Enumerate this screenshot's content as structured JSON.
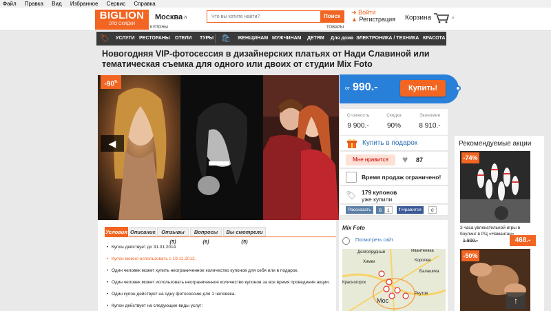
{
  "menubar": [
    "Файл",
    "Правка",
    "Вид",
    "Избранное",
    "Сервис",
    "Справка"
  ],
  "header": {
    "logo_main": "BIGLION",
    "logo_sub": "ЭТО СКИДКИ",
    "city": "Москва",
    "search_placeholder": "Что вы хотите найти?",
    "search_button": "Поиск",
    "login": "Войти",
    "register": "Регистрация",
    "cart": "Корзина",
    "label_coupons": "КУПОНЫ",
    "label_goods": "ТОВАРЫ"
  },
  "nav": {
    "coupons": [
      "УСЛУГИ",
      "РЕСТОРАНЫ",
      "ОТЕЛИ",
      "ТУРЫ"
    ],
    "goods": [
      "ЖЕНЩИНАМ",
      "МУЖЧИНАМ",
      "ДЕТЯМ",
      "Для дома",
      "ЭЛЕКТРОНИКА / ТЕХНИКА",
      "КРАСОТА"
    ]
  },
  "deal": {
    "title": "Новогодняя VIP-фотосессия в дизайнерских платьях от Нади Славиной или тематическая съемка для одного или двоих от студии Mix Foto",
    "discount_badge": "-90",
    "discount_pct": "%",
    "price_prefix": "от",
    "price": "990.-",
    "buy_button": "Купить!",
    "stats": [
      {
        "label": "Стоимость",
        "value": "9 900.-"
      },
      {
        "label": "Скидка",
        "value": "90%"
      },
      {
        "label": "Экономия",
        "value": "8 910.-"
      }
    ],
    "gift": "Купить в подарок",
    "like": "Мне нравится",
    "like_count": "87",
    "time_limit": "Время продаж ограничено!",
    "bought_count": "179 купонов",
    "bought_label": "уже купили",
    "social": {
      "vk": "Рассказать",
      "vk_count": "1",
      "fb": "Нравится",
      "fb_count": "0"
    }
  },
  "recommended": {
    "title": "Рекомендуемые акции",
    "cards": [
      {
        "discount": "-74%",
        "desc": "3 часа увлекательной игры в боулинг в РЦ «Наманган»",
        "old_price": "1 800.-",
        "new_price": "468.-"
      },
      {
        "discount": "-50%"
      }
    ]
  },
  "tabs": [
    {
      "label": "Условия",
      "active": true
    },
    {
      "label": "Описание"
    },
    {
      "label": "Отзывы (5)"
    },
    {
      "label": "Вопросы (6)"
    },
    {
      "label": "Вы смотрели (5)"
    }
  ],
  "conditions": [
    {
      "text": "Купон действует до 31.01.2014"
    },
    {
      "text": "Купон можно использовать с 19.11.2013.",
      "highlight": true
    },
    {
      "text": "Один человек может купить неограниченное количество купонов для себя или в подарок."
    },
    {
      "text": "Один человек может использовать неограниченное количество купонов за все время проведения акции."
    },
    {
      "text": "Один купон действует на одну фотосессию для 1 человека."
    },
    {
      "text": "Купон действует на следующие виды услуг:"
    }
  ],
  "map": {
    "company": "Mix Foto",
    "site_link": "Посмотреть сайт",
    "labels": [
      "Долгопрудный",
      "Ивантеевка",
      "Химки",
      "Королев",
      "Балашиха",
      "Красногорск",
      "Реутов",
      "Мос"
    ]
  },
  "colors": {
    "brand": "#f26522",
    "price_blue": "#2980d9",
    "nav_bg": "#3a3a3a"
  }
}
